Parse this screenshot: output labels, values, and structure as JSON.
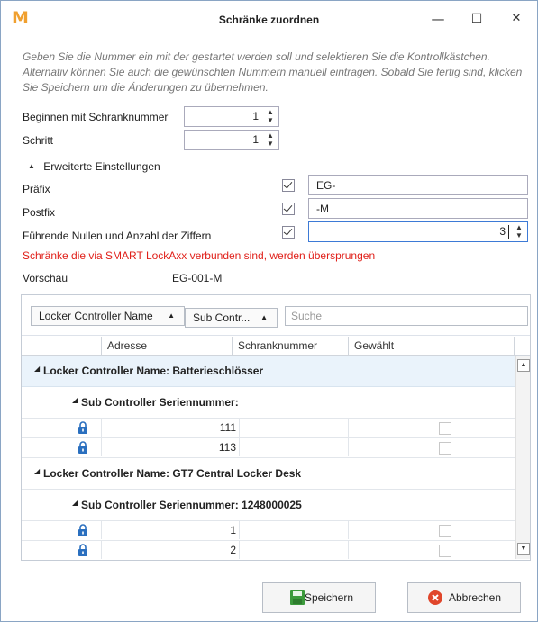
{
  "window": {
    "logo": "M",
    "title": "Schränke zuordnen",
    "min": "—",
    "max": "☐",
    "close": "✕"
  },
  "instructions": "Geben Sie die Nummer ein mit der gestartet werden soll und selektieren Sie die Kontrollkästchen. Alternativ können Sie auch die gewünschten Nummern manuell eintragen. Sobald Sie fertig sind, klicken Sie Speichern um die Änderungen zu übernehmen.",
  "start": {
    "label": "Beginnen mit Schranknummer",
    "value": "1"
  },
  "step": {
    "label": "Schritt",
    "value": "1"
  },
  "advanced": {
    "label": "Erweiterte Einstellungen",
    "arrow": "▲"
  },
  "prefix": {
    "label": "Präfix",
    "value": "EG-",
    "checked": true
  },
  "postfix": {
    "label": "Postfix",
    "value": "-M",
    "checked": true
  },
  "leading": {
    "label": "Führende Nullen und Anzahl der Ziffern",
    "value": "3",
    "checked": true
  },
  "warning": "Schränke die via SMART LockAxx verbunden sind, werden übersprungen",
  "preview": {
    "label": "Vorschau",
    "value": "EG-001-M"
  },
  "grid": {
    "group_btn1": "Locker Controller Name",
    "group_btn2": "Sub Contr...",
    "search_placeholder": "Suche",
    "columns": [
      "Adresse",
      "Schranknummer",
      "Gewählt"
    ],
    "group1": "Locker Controller Name: Batterieschlösser",
    "sub1": "Sub Controller Seriennummer:",
    "rows1": [
      "111",
      "113"
    ],
    "group2": "Locker Controller Name: GT7 Central Locker Desk",
    "sub2": "Sub Controller Seriennummer: 1248000025",
    "rows2": [
      "1",
      "2"
    ],
    "expand": "◢"
  },
  "save": "Speichern",
  "cancel": "Abbrechen",
  "colors": {
    "accent": "#f0a030",
    "warning": "#e0201a",
    "groupbg": "#eaf3fb",
    "lock": "#2a6fbf"
  }
}
